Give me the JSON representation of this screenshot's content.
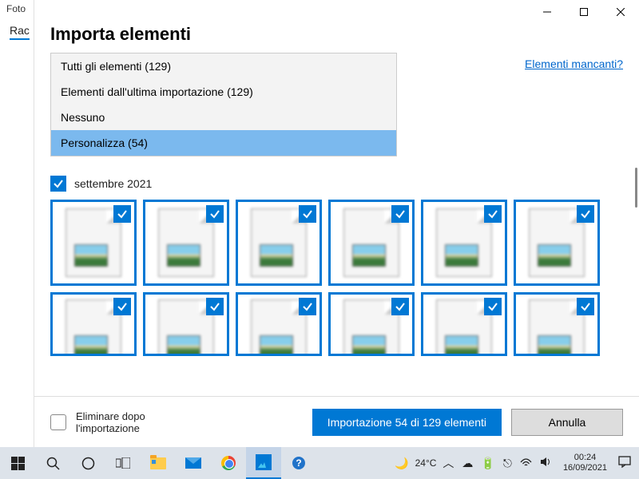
{
  "bg": {
    "title": "Foto",
    "tab": "Rac",
    "more": ". . ."
  },
  "dialog": {
    "title": "Importa elementi",
    "missing_link": "Elementi mancanti?",
    "filters": {
      "all": "Tutti gli elementi (129)",
      "last": "Elementi dall'ultima importazione (129)",
      "none": "Nessuno",
      "custom": "Personalizza (54)"
    },
    "month": "settembre 2021",
    "delete_after": "Eliminare dopo l'importazione",
    "import_btn": "Importazione 54 di 129 elementi",
    "cancel_btn": "Annulla"
  },
  "taskbar": {
    "temp": "24°C",
    "time": "00:24",
    "date": "16/09/2021"
  }
}
